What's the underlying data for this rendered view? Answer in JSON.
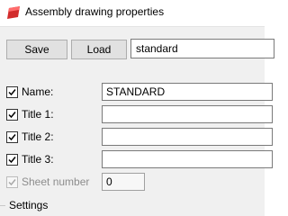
{
  "window": {
    "title": "Assembly drawing properties"
  },
  "toolbar": {
    "save_label": "Save",
    "load_label": "Load",
    "preset_value": "standard"
  },
  "fields": [
    {
      "label": "Name:",
      "value": "STANDARD",
      "checked": true,
      "enabled": true
    },
    {
      "label": "Title 1:",
      "value": "",
      "checked": true,
      "enabled": true
    },
    {
      "label": "Title 2:",
      "value": "",
      "checked": true,
      "enabled": true
    },
    {
      "label": "Title 3:",
      "value": "",
      "checked": true,
      "enabled": true
    },
    {
      "label": "Sheet number",
      "value": "0",
      "checked": true,
      "enabled": false
    }
  ],
  "settings": {
    "label": "Settings"
  },
  "colors": {
    "accent_red": "#d22b2b",
    "panel_bg": "#f0f0f0"
  },
  "icons": {
    "app": "app-logo-icon",
    "check": "checkmark-icon"
  }
}
